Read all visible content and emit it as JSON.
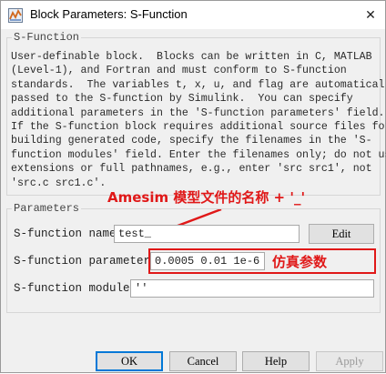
{
  "window": {
    "title": "Block Parameters: S-Function",
    "close_symbol": "✕"
  },
  "sfunction_group": {
    "label": "S-Function",
    "description": "User-definable block.  Blocks can be written in C, MATLAB\n(Level-1), and Fortran and must conform to S-function\nstandards.  The variables t, x, u, and flag are automatically\npassed to the S-function by Simulink.  You can specify\nadditional parameters in the 'S-function parameters' field.\nIf the S-function block requires additional source files for\nbuilding generated code, specify the filenames in the 'S-\nfunction modules' field. Enter the filenames only; do not use\nextensions or full pathnames, e.g., enter 'src src1', not\n'src.c src1.c'."
  },
  "parameters_group": {
    "label": "Parameters",
    "name_label": "S-function name:",
    "name_value": "test_",
    "edit_button": "Edit",
    "params_label": "S-function parameters:",
    "params_value": "0.0005 0.01 1e-6",
    "modules_label": "S-function modules:",
    "modules_value": "''"
  },
  "annotations": {
    "name_note": "Amesim 模型文件的名称 + '_'",
    "params_note": "仿真参数",
    "color": "#e01818"
  },
  "buttons": {
    "ok": "OK",
    "cancel": "Cancel",
    "help": "Help",
    "apply": "Apply"
  },
  "icons": {
    "app": "simulink-block-icon",
    "close": "close-icon"
  }
}
